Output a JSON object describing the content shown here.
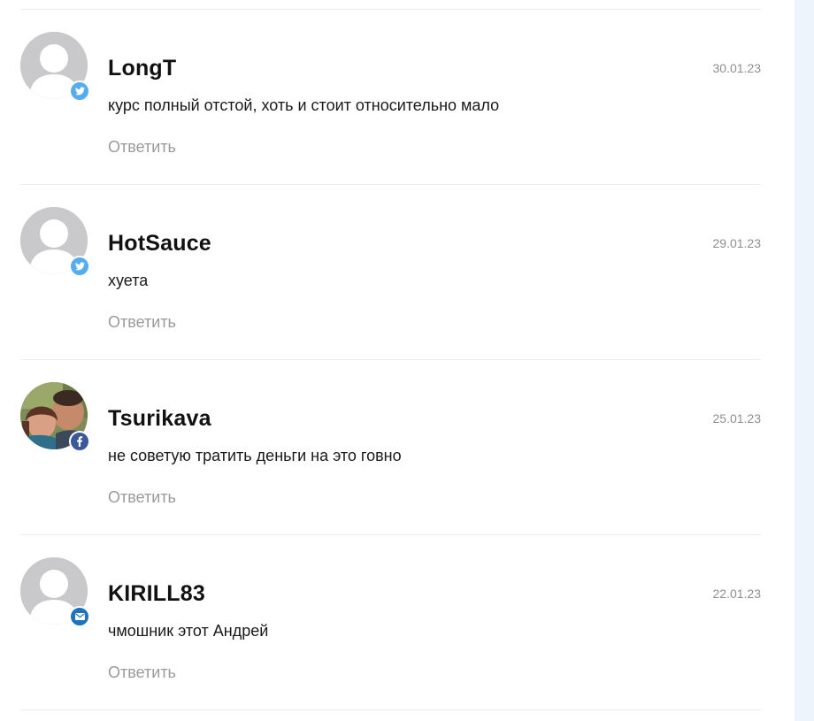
{
  "comments": [
    {
      "author": "LongT",
      "date": "30.01.23",
      "text": "курс полный отстой, хоть и стоит относительно мало",
      "reply_label": "Ответить",
      "avatar": "default-avatar",
      "social": "twitter-icon",
      "social_color": "#55acee"
    },
    {
      "author": "HotSauce",
      "date": "29.01.23",
      "text": "хуета",
      "reply_label": "Ответить",
      "avatar": "default-avatar",
      "social": "twitter-icon",
      "social_color": "#55acee"
    },
    {
      "author": "Tsurikava",
      "date": "25.01.23",
      "text": "не советую тратить деньги на это говно",
      "reply_label": "Ответить",
      "avatar": "user-photo",
      "social": "facebook-icon",
      "social_color": "#3b5998"
    },
    {
      "author": "KIRILL83",
      "date": "22.01.23",
      "text": "чмошник этот Андрей",
      "reply_label": "Ответить",
      "avatar": "default-avatar",
      "social": "mail-icon",
      "social_color": "#1e73be"
    }
  ],
  "colors": {
    "divider": "#ececec",
    "reply_text": "#9a9a9a",
    "date_text": "#8e8e8e",
    "sidebar_bg": "#eef4fc"
  }
}
